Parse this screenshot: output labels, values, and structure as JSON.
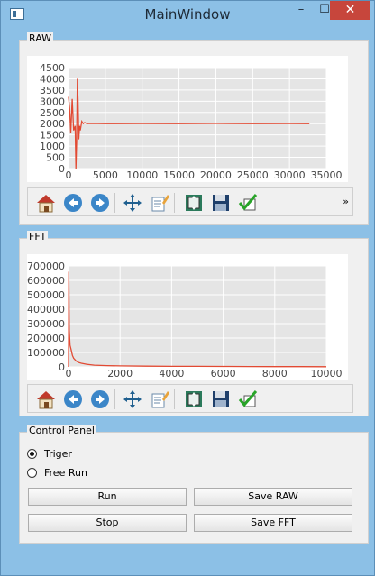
{
  "window": {
    "title": "MainWindow",
    "minimize": "–",
    "maximize": "☐",
    "close": "✕"
  },
  "raw_group": {
    "title": "RAW"
  },
  "fft_group": {
    "title": "FFT"
  },
  "control_panel": {
    "title": "Control Panel",
    "radio_triger": "Triger",
    "radio_free_run": "Free Run",
    "run_button": "Run",
    "save_raw_button": "Save RAW",
    "stop_button": "Stop",
    "save_fft_button": "Save FFT",
    "selected_mode": "Triger"
  },
  "toolbar": {
    "icons": [
      "home-icon",
      "back-arrow-icon",
      "forward-arrow-icon",
      "pan-move-icon",
      "zoom-edit-icon",
      "configure-subplots-icon",
      "save-floppy-icon",
      "checkmark-icon"
    ],
    "overflow": "»"
  },
  "colors": {
    "line": "#e24a33",
    "plot_bg": "#e5e5e5",
    "grid": "#ffffff"
  },
  "chart_data": [
    {
      "type": "line",
      "title": "",
      "xlabel": "",
      "ylabel": "",
      "xlim": [
        0,
        35000
      ],
      "ylim": [
        0,
        4500
      ],
      "xticks": [
        "0",
        "5000",
        "10000",
        "15000",
        "20000",
        "25000",
        "30000",
        "35000"
      ],
      "yticks": [
        "0",
        "500",
        "1000",
        "1500",
        "2000",
        "2500",
        "3000",
        "3500",
        "4000",
        "4500"
      ],
      "series": [
        {
          "x": [
            0,
            150,
            300,
            500,
            700,
            900,
            1000,
            1100,
            1200,
            1300,
            1400,
            1500,
            1600,
            1800,
            2000,
            2200,
            2500,
            3000,
            5000,
            10000,
            15000,
            20000,
            25000,
            30000,
            32700
          ],
          "y": [
            3200,
            2700,
            1600,
            3100,
            1700,
            1900,
            0,
            1200,
            4000,
            3000,
            1300,
            1900,
            1700,
            2100,
            2000,
            2050,
            2000,
            2010,
            2000,
            2005,
            2000,
            2010,
            2000,
            2005,
            2000
          ]
        }
      ]
    },
    {
      "type": "line",
      "title": "",
      "xlabel": "",
      "ylabel": "",
      "xlim": [
        0,
        10000
      ],
      "ylim": [
        0,
        700000
      ],
      "xticks": [
        "0",
        "2000",
        "4000",
        "6000",
        "8000",
        "10000"
      ],
      "yticks": [
        "0",
        "100000",
        "200000",
        "300000",
        "400000",
        "500000",
        "600000",
        "700000"
      ],
      "series": [
        {
          "x": [
            0,
            10,
            30,
            60,
            100,
            150,
            200,
            300,
            400,
            500,
            700,
            1000,
            1500,
            2000,
            3000,
            4000,
            5000,
            6000,
            7000,
            8000,
            9000,
            10000
          ],
          "y": [
            0,
            660000,
            250000,
            150000,
            120000,
            80000,
            60000,
            40000,
            30000,
            25000,
            18000,
            12000,
            9000,
            7000,
            5000,
            4000,
            3500,
            3000,
            2500,
            2000,
            1800,
            1500
          ]
        }
      ]
    }
  ]
}
